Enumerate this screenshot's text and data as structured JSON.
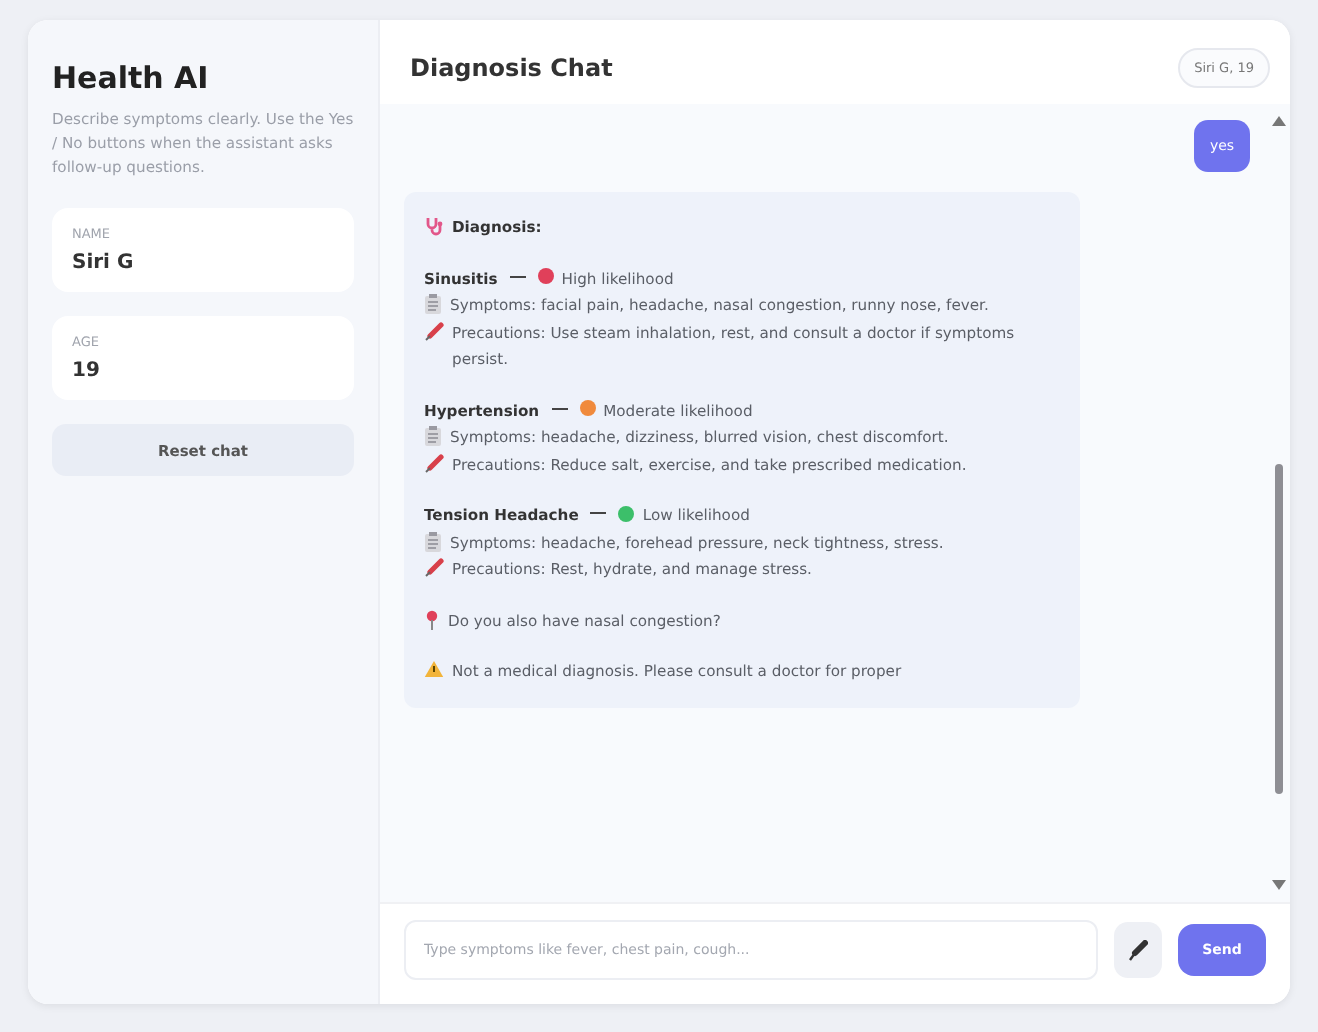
{
  "sidebar": {
    "title": "Health AI",
    "description": "Describe symptoms clearly. Use the Yes / No buttons when the assistant asks follow-up questions.",
    "fields": [
      {
        "label": "NAME",
        "value": "Siri G"
      },
      {
        "label": "AGE",
        "value": "19"
      }
    ],
    "reset_button": "Reset chat"
  },
  "chat": {
    "title": "Diagnosis Chat",
    "user_badge": "Siri G, 19",
    "messages": [
      {
        "kind": "user",
        "text": "yes"
      },
      {
        "kind": "assistant",
        "heading": "Diagnosis:",
        "conditions": [
          {
            "name": "Sinusitis",
            "likelihood": "High likelihood",
            "color": "#e0405a",
            "symptoms": "Symptoms: facial pain, headache, nasal congestion, runny nose, fever.",
            "precautions": "Precautions: Use steam inhalation, rest, and consult a doctor if symptoms persist."
          },
          {
            "name": "Hypertension",
            "likelihood": "Moderate likelihood",
            "color": "#f08a3c",
            "symptoms": "Symptoms: headache, dizziness, blurred vision, chest discomfort.",
            "precautions": "Precautions: Reduce salt, exercise, and take prescribed medication."
          },
          {
            "name": "Tension Headache",
            "likelihood": "Low likelihood",
            "color": "#3cbf6a",
            "symptoms": "Symptoms: headache, forehead pressure, neck tightness, stress.",
            "precautions": "Precautions: Rest, hydrate, and manage stress."
          }
        ],
        "question": "Do you also have nasal congestion?",
        "disclaimer": "Not a medical diagnosis. Please consult a doctor for proper"
      }
    ],
    "input": {
      "placeholder": "Type symptoms like fever, chest pain, cough..."
    },
    "send_button": "Send"
  }
}
